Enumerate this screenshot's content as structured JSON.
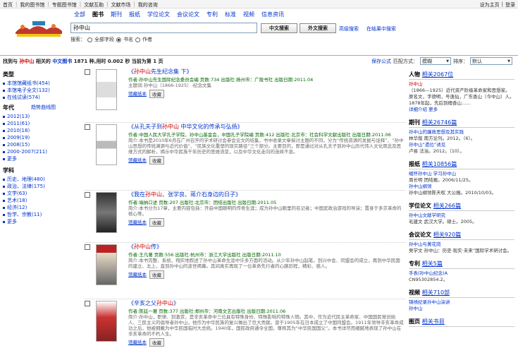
{
  "topbar": {
    "links": [
      "首页",
      "我的图书馆",
      "专题图书馆",
      "文献互助",
      "文献市场",
      "我的咨询"
    ],
    "right": [
      "设为主页",
      "登录"
    ]
  },
  "nav": {
    "tabs": [
      "全部",
      "图书",
      "期刊",
      "报纸",
      "学位论文",
      "会议论文",
      "专利",
      "标准",
      "视频",
      "信息资讯"
    ],
    "active_index": 1
  },
  "search": {
    "value": "孙中山",
    "btn_cn": "中文搜索",
    "btn_foreign": "外文搜索",
    "advanced": "高级搜索",
    "in_results": "在结果中搜索",
    "scope_label": "搜索：",
    "scopes": [
      "全部字段",
      "书名",
      "作者"
    ],
    "scope_selected": 1
  },
  "status": {
    "prefix": "找到与",
    "keyword": "孙中山",
    "mid": "相关的",
    "type": "中文图书",
    "count": "1871",
    "rest": "种,用时 0.002 秒 当前为第 1 页"
  },
  "sort": {
    "save": "保存公式",
    "match_label": "匹配方式：",
    "match_value": "模糊",
    "order_label": "排序：",
    "order_value": "默认"
  },
  "facets": {
    "type_title": "类型",
    "types": [
      "本馆馆藏纸书(454)",
      "本馆电子全文(132)",
      "在线试读(574)"
    ],
    "year_title": "年代",
    "year_chart": "趋势曲线图",
    "years": [
      "2012(13)",
      "2011(61)",
      "2010(18)",
      "2009(19)",
      "2008(15)",
      "2000-2007(211)",
      "更多"
    ],
    "subject_title": "学科",
    "subjects": [
      "历史、地理(480)",
      "政治、法律(175)",
      "文学(63)",
      "艺术(18)",
      "经济(12)",
      "哲学、宗教(11)",
      "更多"
    ]
  },
  "results": [
    {
      "t_pre": "《",
      "kw": "孙中山",
      "t_post": "先生纪念集 下》",
      "meta": "作者:孙中山先生国际纪念委员会编 页数:734 出版社:扬州市：广陵书社 出版日期:2011.04",
      "desc": "主题词:孙中山（1866-1925）-纪念文集",
      "read": "馆藏纸本",
      "fav": "收藏"
    },
    {
      "t_pre": "《从孔夫子到",
      "kw": "孙中山",
      "t_post": " 中华文化的传承与弘扬》",
      "meta": "作者:中国人民大学孔子学院，孙中山基金会，中国孔子学院编 页数:412 出版社:北京市：社会科学文献出版社 出版日期:2011.06",
      "desc": "简介:本书是2010年6月在广州召开的学术研讨会参会论文的结集，书中收录文章探讨主题的不同，分为“传统资源的发掘与诠释”、“孙中山思想的传统渊源与近代价值”、“民族文化重塑的现实路径”三个部分。主要目的，即是通过对从孔夫子到孙中山历代伟人文化观念及思维方式的解析，揭示中华民族千年历史的思维流变，以及中华文化走向的连续不息。",
      "read": "馆藏纸本",
      "fav": "收藏"
    },
    {
      "t_pre": "《我在",
      "kw": "孙中山",
      "t_post": "、张学良、蒋介石身边的日子》",
      "meta": "作者:端纳口述 页数:207 出版社:北京市：团结出版社 出版日期:2011.05",
      "desc": "简介:本书分为17章，主要内容包括：开启中国眼明的传奇生涯；成为孙中山眼里的名记者；中国武政治游戏的导演；置身于多京革命的核心等。",
      "read": "馆藏纸本",
      "fav": "收藏"
    },
    {
      "t_pre": "《",
      "kw": "孙中山",
      "t_post": "传》",
      "meta": "作者:王凡著 页数:556 出版社:杭州市：浙江大学出版社 出版日期:2011.10",
      "desc": "简介:本书完整、系统、翔实地叙述了孙中山革命生涯中许多方面的活动。从少年孙中山起笔，到兴中会、同盟会的成立，再到中华民国的建立、北上，直到孙中山的逝世揭幕。其间真实再现了一位革命先行者的心路历程，精彩、感人。",
      "read": "馆藏纸本",
      "fav": "收藏"
    },
    {
      "t_pre": "《辛亥之父",
      "kw": "孙中山",
      "t_post": "》",
      "meta": "作者:陈廷一著 页数:377 出版社:郑州市：河南文艺出版社 出版日期:2011.06",
      "desc": "简介:孙中山，职律、到激赏，是辛亥革命中三位具有特殊身份、特殊影响的特殊人物。其中，作为近代民主革命家、中国国民党创始人、三民主义的倡导者孙中山，他作为中华民族的复兴做出了巨大贡献。曾于1905年在日本成立了中国同盟会。1911年领导辛亥革命成功之后，他被拥戴为中华民国临时大总统。1940年，国民政府通令全国，尊称其为“中华民国国父”。本书详尽而细腻地表现了孙中山在辛亥革命的不朽人生。",
      "read": "馆藏纸本",
      "fav": "收藏"
    }
  ],
  "right": {
    "person": {
      "title": "人物",
      "link": "相关2067位",
      "name": "孙中山",
      "text": "（1866—1925）近代资产阶级革命家和思想家。原名文，字德明，号逸仙，广东香山（今中山）人。1878年起，先后到檀香山……",
      "more1": "详细介绍",
      "more2": "更多"
    },
    "journal": {
      "title": "期刊",
      "link": "相关26746篇",
      "l1": "孙中山的廉政思想及其实践",
      "l2": "林华煌  南方论刊。2012。（6）。",
      "l3": "孙中山“遗位”诱见",
      "l4": "卢易  法治。2012。（10）。"
    },
    "paper": {
      "title": "报纸",
      "link": "相关10856篇",
      "l1": "缅怀孙中山 学习孙中山",
      "l2": "周长明  团结报。2006/11/25。",
      "l3": "孙中山纲领",
      "l4": "孙中山纲领陈天权  大公报。2010/10/03。"
    },
    "thesis": {
      "title": "学位论文",
      "link": "相关266篇",
      "l1": "孙中山文献学研究",
      "l2": "毛建文  武汉大学。硕士。2005。"
    },
    "conf": {
      "title": "会议论文",
      "link": "相关920篇",
      "l1": "孙中山与黄花岗",
      "l2": "吴学文  孙中山：历史·现实·未来”国际学术研讨会。"
    },
    "patent": {
      "title": "专利",
      "link": "相关5篇",
      "l1": "手表(孙中山纪念)A",
      "l2": "CN95302854.2。"
    },
    "video": {
      "title": "视频",
      "link": "相关710部",
      "l1": "锦绣纪录孙中山演讲",
      "l2": "孙中山"
    },
    "book": {
      "title": "图页",
      "link": "相关书目"
    }
  }
}
